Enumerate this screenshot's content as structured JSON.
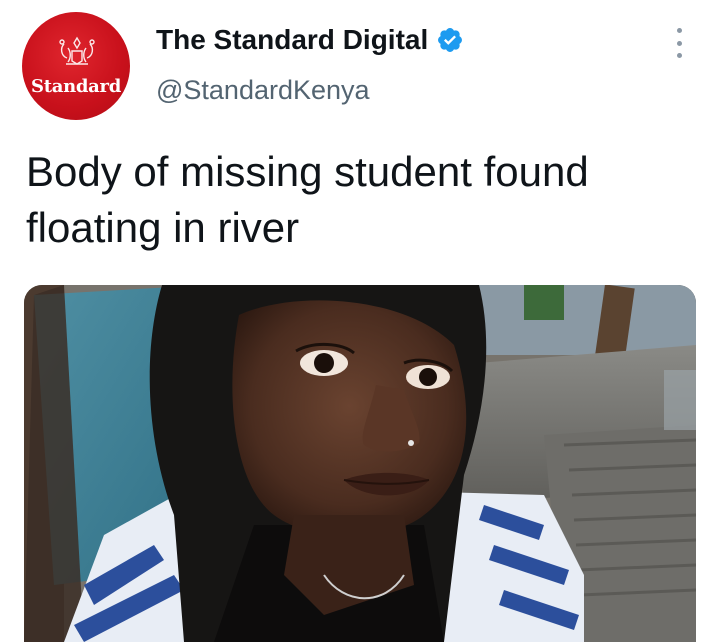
{
  "account": {
    "display_name": "The Standard Digital",
    "handle": "@StandardKenya",
    "avatar_text": "Standard",
    "verified": true,
    "avatar_color": "#c8101b",
    "verified_color": "#1d9bf0"
  },
  "tweet": {
    "text": "Body of missing student found floating in river"
  },
  "media": {
    "icon": "photo-of-woman-in-black-headscarf"
  },
  "menu": {
    "icon": "more-options-icon"
  }
}
